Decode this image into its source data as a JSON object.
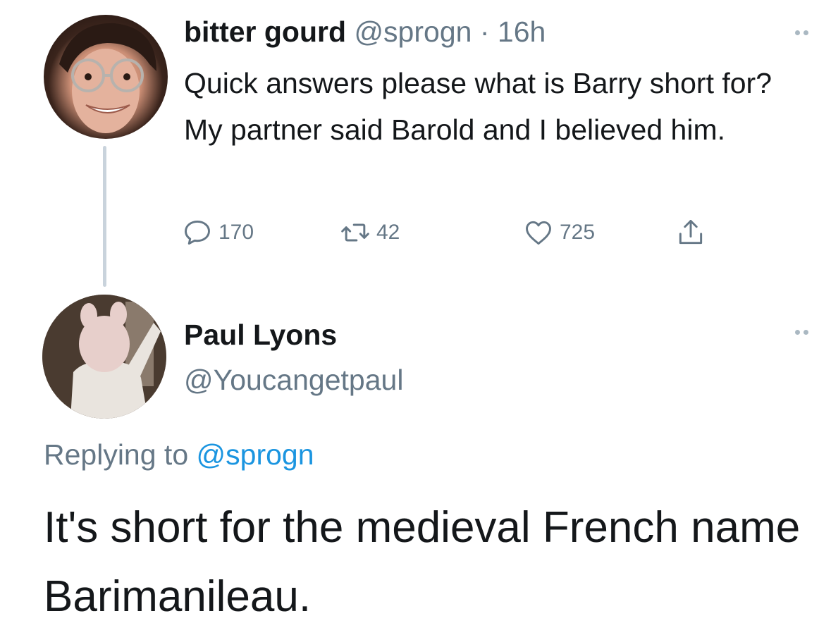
{
  "original_tweet": {
    "display_name": "bitter gourd",
    "handle": "@sprogn",
    "separator": "·",
    "time": "16h",
    "text": "Quick answers please what is Barry short for? My partner said Barold and I believed him.",
    "reply_count": "170",
    "retweet_count": "42",
    "like_count": "725",
    "icons": {
      "reply": "reply-icon",
      "retweet": "retweet-icon",
      "like": "heart-icon",
      "share": "share-icon",
      "more": "more-icon"
    }
  },
  "reply_tweet": {
    "display_name": "Paul Lyons",
    "handle": "@Youcangetpaul",
    "replying_prefix": "Replying to",
    "replying_handle": "@sprogn",
    "text": "It's short for the medieval French name Barimanileau."
  },
  "colors": {
    "text_primary": "#14171a",
    "text_secondary": "#657786",
    "link": "#1b95e0",
    "thread_line": "#c9d3dc"
  }
}
